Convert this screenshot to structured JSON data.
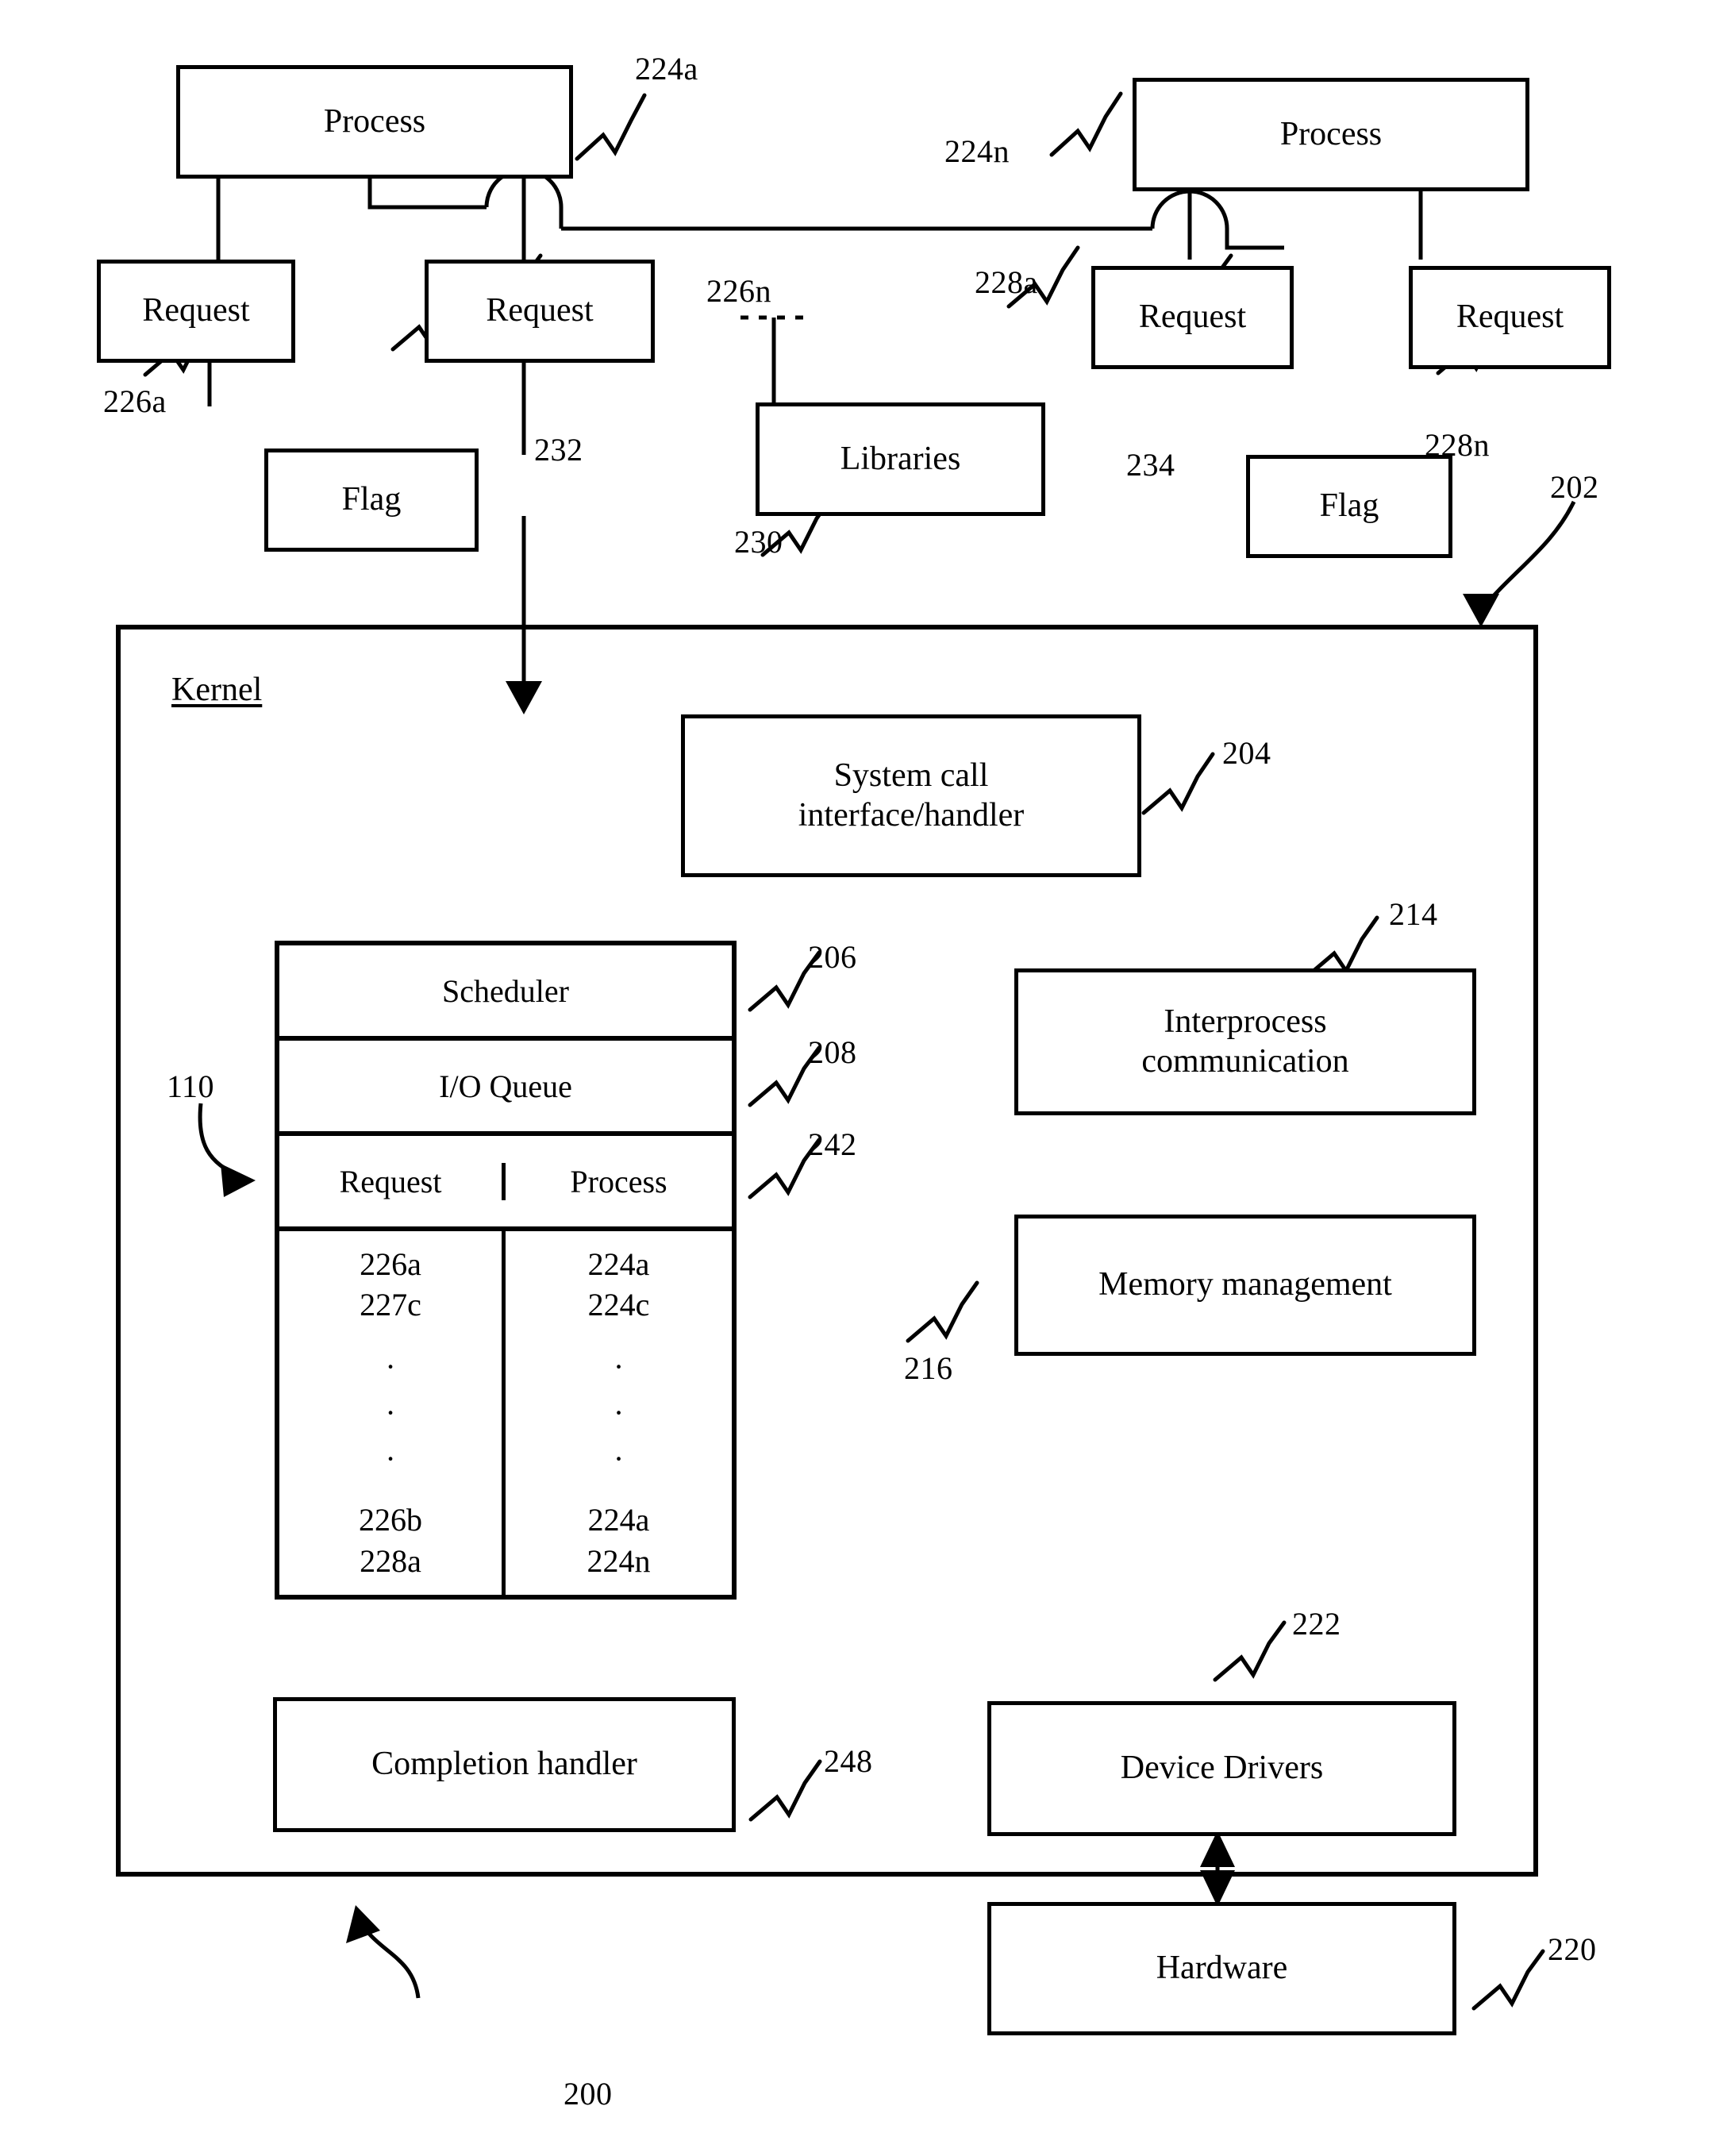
{
  "figure": {
    "number": "200",
    "kernel_label": "Kernel"
  },
  "user_space": {
    "process_left": {
      "label": "Process",
      "ref": "224a"
    },
    "process_right": {
      "label": "Process",
      "ref": "224n"
    },
    "request_left_a": {
      "label": "Request",
      "ref": "226a"
    },
    "request_left_n": {
      "label": "Request",
      "ref": "226n"
    },
    "request_right_a": {
      "label": "Request",
      "ref": "228a"
    },
    "request_right_n": {
      "label": "Request",
      "ref": "228n"
    },
    "flag_left": {
      "label": "Flag",
      "ref": "232"
    },
    "flag_right": {
      "label": "Flag",
      "ref": "234"
    },
    "libraries": {
      "label": "Libraries",
      "ref": "230"
    }
  },
  "kernel": {
    "ref": "202",
    "syscall": {
      "label": "System call\ninterface/handler",
      "ref": "204"
    },
    "scheduler": {
      "label": "Scheduler",
      "ref": "206"
    },
    "io_queue": {
      "label": "I/O Queue",
      "ref": "208"
    },
    "queue_table": {
      "ref": "242",
      "pointer_ref": "110",
      "headers": [
        "Request",
        "Process"
      ],
      "request_top": [
        "226a",
        "227c"
      ],
      "process_top": [
        "224a",
        "224c"
      ],
      "ellipsis": [
        "·",
        "·",
        "·"
      ],
      "request_bottom": [
        "226b",
        "228a"
      ],
      "process_bottom": [
        "224a",
        "224n"
      ]
    },
    "interprocess": {
      "label": "Interprocess\ncommunication",
      "ref": "214"
    },
    "memory": {
      "label": "Memory management",
      "ref": "216"
    },
    "completion": {
      "label": "Completion handler",
      "ref": "248"
    },
    "device_drivers": {
      "label": "Device Drivers",
      "ref": "222"
    }
  },
  "hardware": {
    "label": "Hardware",
    "ref": "220"
  }
}
